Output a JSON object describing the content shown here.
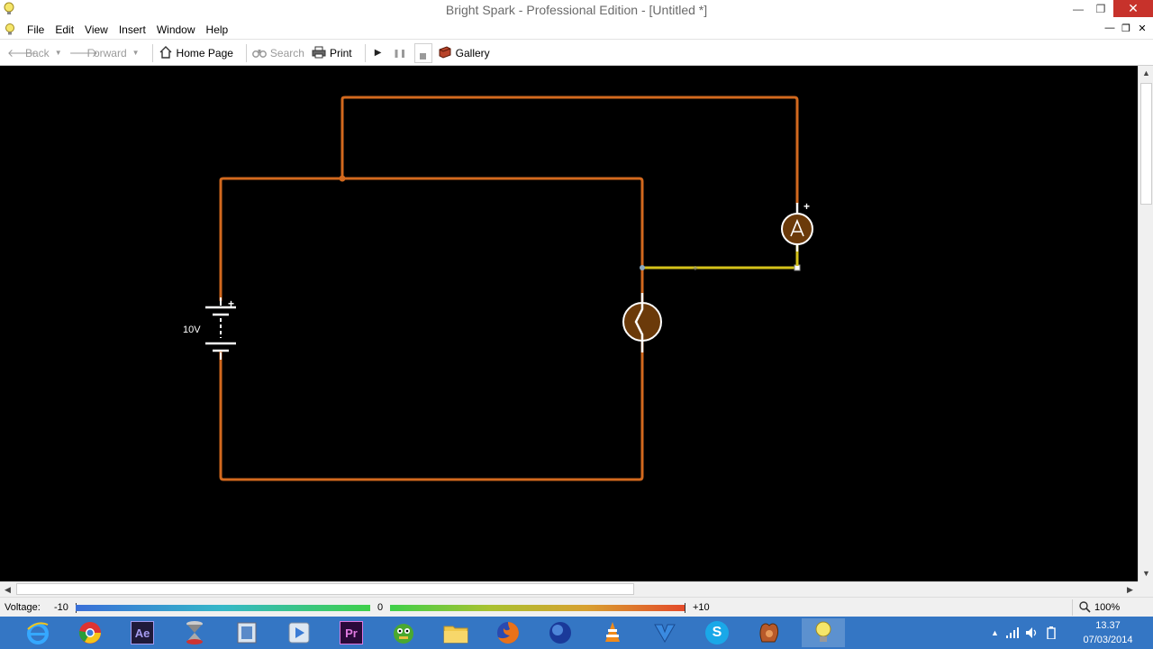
{
  "window": {
    "title": "Bright Spark - Professional Edition - [Untitled *]",
    "controls": {
      "minimize": "—",
      "maximize": "❐",
      "close": "✕"
    }
  },
  "menu": {
    "items": [
      "File",
      "Edit",
      "View",
      "Insert",
      "Window",
      "Help"
    ],
    "mdi_controls": {
      "minimize": "—",
      "restore": "❐",
      "close": "✕"
    }
  },
  "toolbar": {
    "back": "Back",
    "forward": "Forward",
    "home": "Home Page",
    "search": "Search",
    "print": "Print",
    "gallery": "Gallery"
  },
  "circuit": {
    "battery_label": "10V",
    "wire_color": "#d2691e",
    "selected_wire_color": "#d4c21a",
    "component_fill": "#6b3a0a",
    "battery_plus": "+",
    "ammeter_plus": "+",
    "ammeter_letter": "A"
  },
  "statusbar": {
    "voltage_label": "Voltage:",
    "min": "-10",
    "mid": "0",
    "max": "+10",
    "zoom": "100%"
  },
  "taskbar": {
    "apps": [
      "internet-explorer",
      "chrome",
      "after-effects",
      "unknown-app",
      "file-manager",
      "media-player",
      "premiere",
      "game-app",
      "file-explorer",
      "firefox",
      "globe-app",
      "vlc",
      "vpn-app",
      "skype",
      "glove-app",
      "bright-spark"
    ],
    "clock_time": "13.37",
    "clock_date": "07/03/2014"
  }
}
